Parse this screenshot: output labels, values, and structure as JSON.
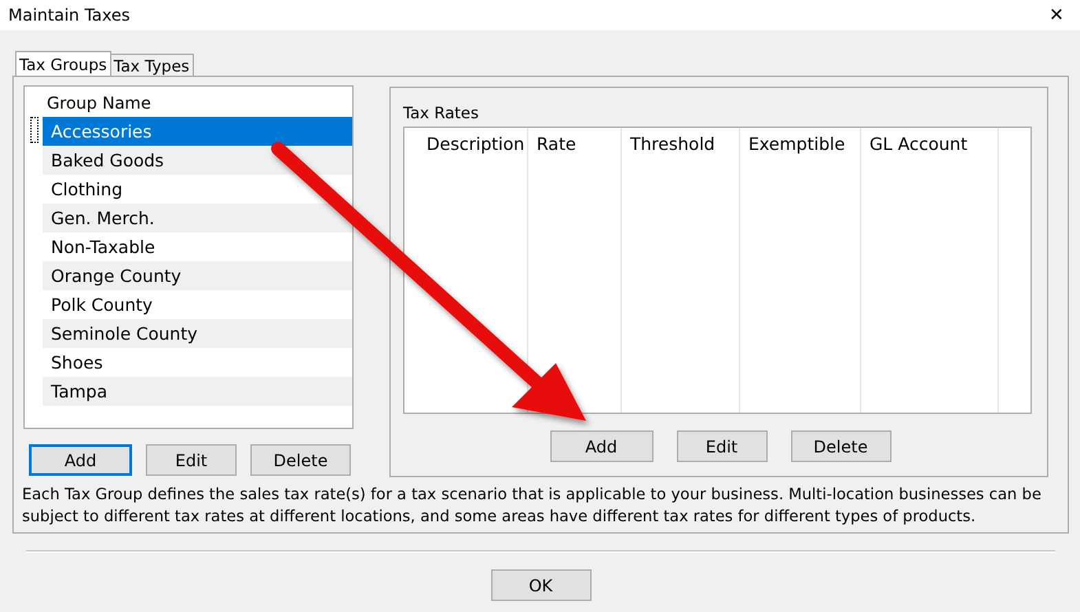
{
  "window": {
    "title": "Maintain Taxes",
    "close": "✕"
  },
  "tabs": [
    {
      "label": "Tax Groups",
      "selected": true
    },
    {
      "label": "Tax Types",
      "selected": false
    }
  ],
  "groups": {
    "column": "Group Name",
    "rows": [
      {
        "name": "Accessories",
        "selected": true
      },
      {
        "name": "Baked Goods",
        "selected": false
      },
      {
        "name": "Clothing",
        "selected": false
      },
      {
        "name": "Gen. Merch.",
        "selected": false
      },
      {
        "name": "Non-Taxable",
        "selected": false
      },
      {
        "name": "Orange County",
        "selected": false
      },
      {
        "name": "Polk County",
        "selected": false
      },
      {
        "name": "Seminole County",
        "selected": false
      },
      {
        "name": "Shoes",
        "selected": false
      },
      {
        "name": "Tampa",
        "selected": false
      }
    ],
    "buttons": [
      {
        "label": "Add",
        "focused": true
      },
      {
        "label": "Edit",
        "focused": false
      },
      {
        "label": "Delete",
        "focused": false
      }
    ]
  },
  "tax_rates": {
    "title": "Tax Rates",
    "columns": [
      "Description",
      "Rate",
      "Threshold",
      "Exemptible",
      "GL Account"
    ],
    "buttons": [
      {
        "label": "Add",
        "focused": false
      },
      {
        "label": "Edit",
        "focused": false
      },
      {
        "label": "Delete",
        "focused": false
      }
    ]
  },
  "description": "Each Tax Group defines the sales tax rate(s) for a tax scenario that is applicable to your business. Multi-location businesses can be subject to different tax rates at different locations, and some areas have different tax rates for different types of products.",
  "ok_button": "OK"
}
